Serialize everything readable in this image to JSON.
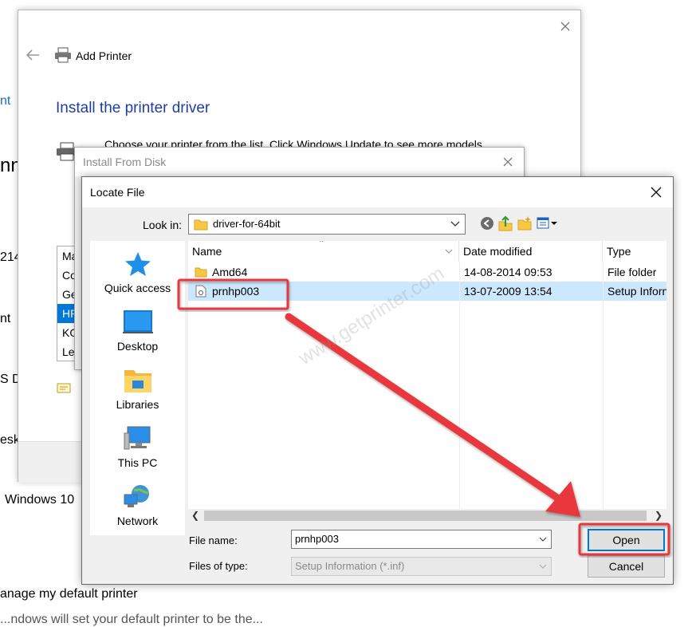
{
  "background_page": {
    "left_fragments": [
      "nt",
      "nn",
      "214",
      "nt",
      "S D",
      "esk"
    ],
    "windows10_text": "Windows 10",
    "manage_text": "anage my default printer",
    "bottom_partial": "...ndows will set your default printer to be the..."
  },
  "wizard": {
    "title": "Add Printer",
    "heading": "Install the printer driver",
    "instruction": "Choose your printer from the list. Click Windows Update to see more models.",
    "manufacturer_list": [
      "Ma",
      "Co",
      "Ge",
      "HP",
      "KO",
      "Le"
    ],
    "selected_manufacturer_index": 3
  },
  "install_from_disk": {
    "title": "Install From Disk"
  },
  "locate_file": {
    "title": "Locate File",
    "look_in_label": "Look in:",
    "look_in_value": "driver-for-64bit",
    "nav_items": [
      {
        "label": "Quick access",
        "icon": "star-icon"
      },
      {
        "label": "Desktop",
        "icon": "desktop-icon"
      },
      {
        "label": "Libraries",
        "icon": "libraries-icon"
      },
      {
        "label": "This PC",
        "icon": "computer-icon"
      },
      {
        "label": "Network",
        "icon": "network-icon"
      }
    ],
    "columns": {
      "name": "Name",
      "date": "Date modified",
      "type": "Type"
    },
    "files": [
      {
        "name": "Amd64",
        "date": "14-08-2014 09:53",
        "type": "File folder",
        "icon": "folder-icon"
      },
      {
        "name": "prnhp003",
        "date": "13-07-2009 13:54",
        "type": "Setup Inforn",
        "icon": "setup-file-icon"
      }
    ],
    "selected_file_index": 1,
    "file_name_label": "File name:",
    "file_name_value": "prnhp003",
    "file_type_label": "Files of type:",
    "file_type_value": "Setup Information (*.inf)",
    "open_label": "Open",
    "cancel_label": "Cancel"
  },
  "watermark": "www.getprinter.com",
  "colors": {
    "accent": "#0078d7",
    "heading_blue": "#1f3f9e",
    "selection": "#cce8ff",
    "annotation_red": "#e8383d"
  }
}
